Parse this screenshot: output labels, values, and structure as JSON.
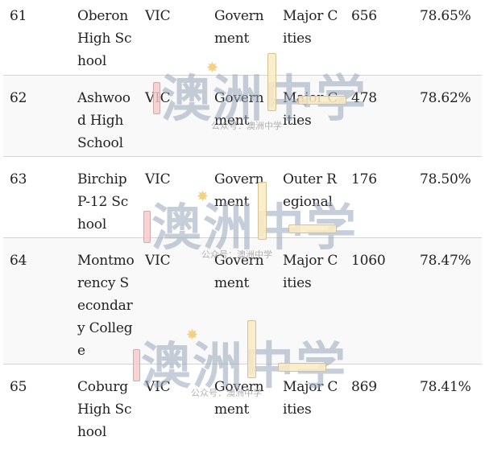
{
  "rows": [
    {
      "rank": "61",
      "school": "Oberon High School",
      "state": "VIC",
      "sector": "Government",
      "region": "Major Cities",
      "count": "656",
      "percent": "78.65%"
    },
    {
      "rank": "62",
      "school": "Ashwood High School",
      "state": "VIC",
      "sector": "Government",
      "region": "Major Cities",
      "count": "478",
      "percent": "78.62%"
    },
    {
      "rank": "63",
      "school": "Birchip P-12 School",
      "state": "VIC",
      "sector": "Government",
      "region": "Outer Regional",
      "count": "176",
      "percent": "78.50%"
    },
    {
      "rank": "64",
      "school": "Montmorency Secondary College",
      "state": "VIC",
      "sector": "Government",
      "region": "Major Cities",
      "count": "1060",
      "percent": "78.47%"
    },
    {
      "rank": "65",
      "school": "Coburg High School",
      "state": "VIC",
      "sector": "Government",
      "region": "Major Cities",
      "count": "869",
      "percent": "78.41%"
    }
  ],
  "watermark": {
    "title": "澳洲中学",
    "subtitle": "公众号：澳洲中学"
  }
}
